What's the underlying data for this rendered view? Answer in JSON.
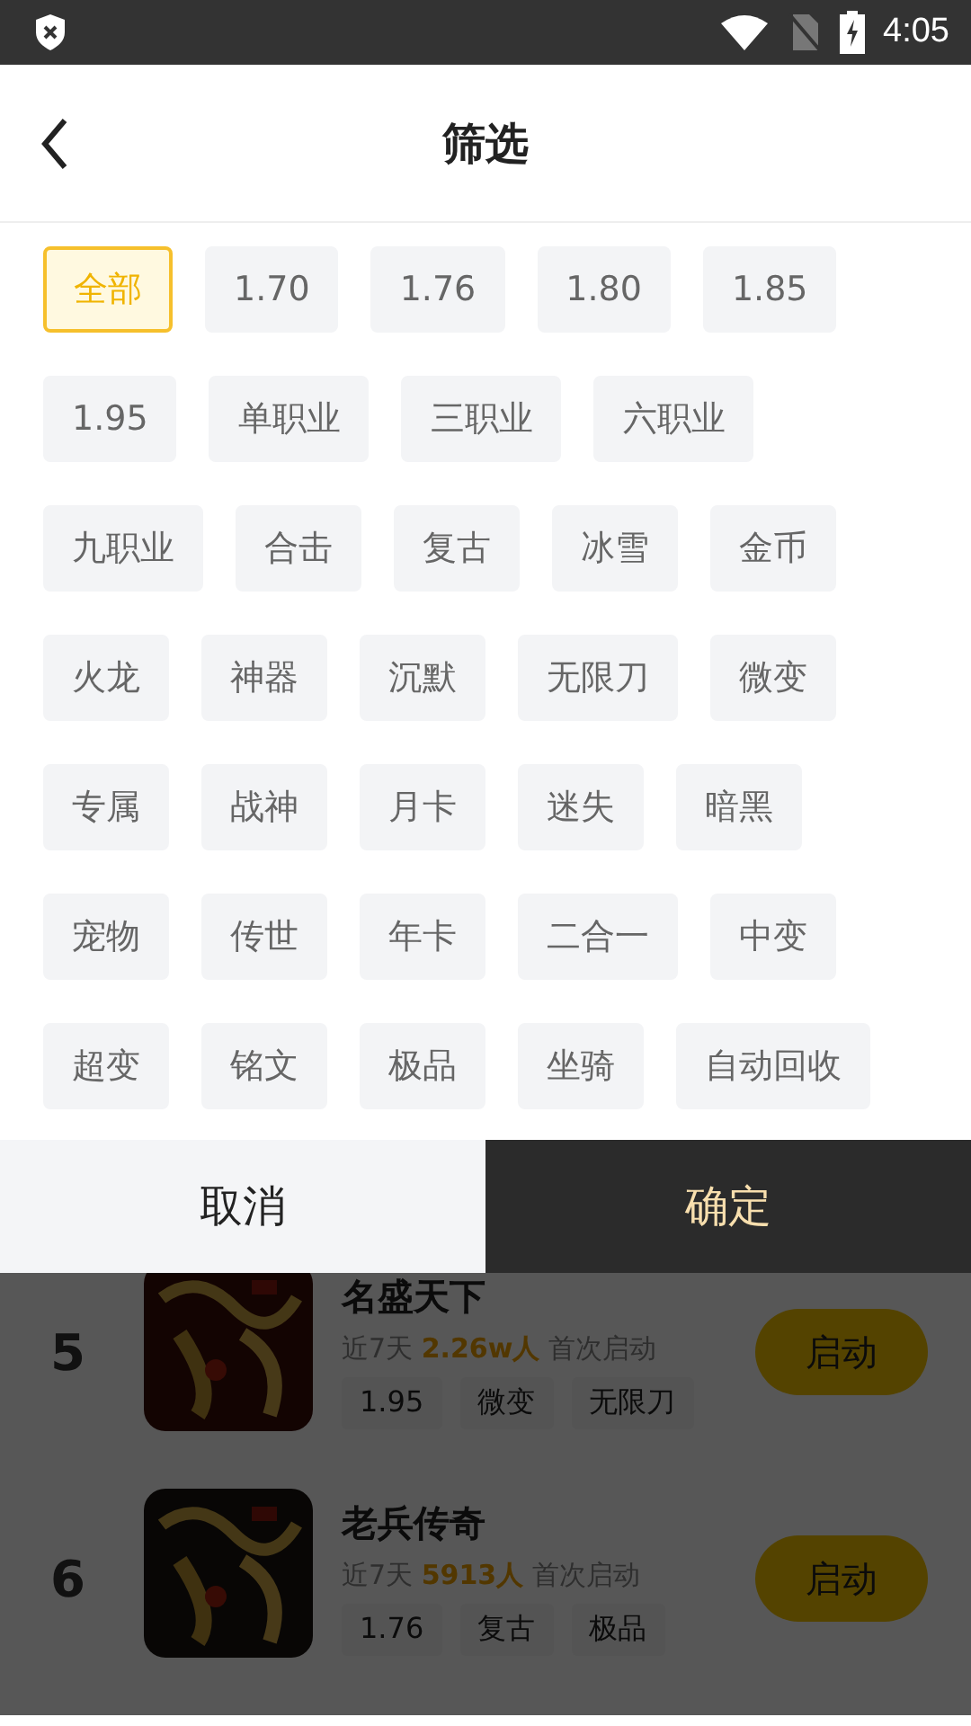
{
  "status_bar": {
    "time": "4:05"
  },
  "header": {
    "title": "筛选"
  },
  "tag_rows": [
    [
      {
        "label": "全部",
        "selected": true
      },
      {
        "label": "1.70",
        "selected": false
      },
      {
        "label": "1.76",
        "selected": false
      },
      {
        "label": "1.80",
        "selected": false
      },
      {
        "label": "1.85",
        "selected": false
      }
    ],
    [
      {
        "label": "1.95",
        "selected": false
      },
      {
        "label": "单职业",
        "selected": false
      },
      {
        "label": "三职业",
        "selected": false
      },
      {
        "label": "六职业",
        "selected": false
      }
    ],
    [
      {
        "label": "九职业",
        "selected": false
      },
      {
        "label": "合击",
        "selected": false
      },
      {
        "label": "复古",
        "selected": false
      },
      {
        "label": "冰雪",
        "selected": false
      },
      {
        "label": "金币",
        "selected": false
      }
    ],
    [
      {
        "label": "火龙",
        "selected": false
      },
      {
        "label": "神器",
        "selected": false
      },
      {
        "label": "沉默",
        "selected": false
      },
      {
        "label": "无限刀",
        "selected": false
      },
      {
        "label": "微变",
        "selected": false
      }
    ],
    [
      {
        "label": "专属",
        "selected": false
      },
      {
        "label": "战神",
        "selected": false
      },
      {
        "label": "月卡",
        "selected": false
      },
      {
        "label": "迷失",
        "selected": false
      },
      {
        "label": "暗黑",
        "selected": false
      }
    ],
    [
      {
        "label": "宠物",
        "selected": false
      },
      {
        "label": "传世",
        "selected": false
      },
      {
        "label": "年卡",
        "selected": false
      },
      {
        "label": "二合一",
        "selected": false
      },
      {
        "label": "中变",
        "selected": false
      }
    ],
    [
      {
        "label": "超变",
        "selected": false
      },
      {
        "label": "铭文",
        "selected": false
      },
      {
        "label": "极品",
        "selected": false
      },
      {
        "label": "坐骑",
        "selected": false
      },
      {
        "label": "自动回收",
        "selected": false
      }
    ]
  ],
  "actions": {
    "cancel": "取消",
    "confirm": "确定"
  },
  "games": [
    {
      "rank": "5",
      "title": "名盛天下",
      "stat_prefix": "近7天",
      "stat_count": "2.26w人",
      "stat_suffix": "首次启动",
      "tags": [
        "1.95",
        "微变",
        "无限刀"
      ],
      "button": "启动"
    },
    {
      "rank": "6",
      "title": "老兵传奇",
      "stat_prefix": "近7天",
      "stat_count": "5913人",
      "stat_suffix": "首次启动",
      "tags": [
        "1.76",
        "复古",
        "极品"
      ],
      "button": "启动"
    }
  ]
}
